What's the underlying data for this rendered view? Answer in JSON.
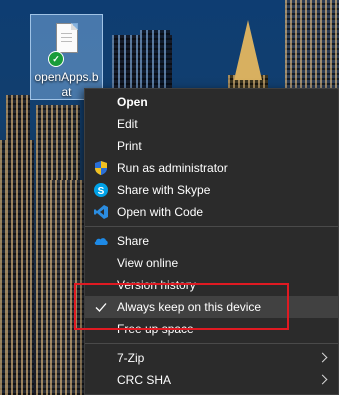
{
  "desktop": {
    "file_icon": {
      "name": "openApps.bat",
      "status_icon": "check-circle-icon"
    }
  },
  "context_menu": {
    "items": [
      {
        "label": "Open",
        "bold": true
      },
      {
        "label": "Edit"
      },
      {
        "label": "Print"
      },
      {
        "label": "Run as administrator",
        "icon": "shield-icon"
      },
      {
        "label": "Share with Skype",
        "icon": "skype-icon"
      },
      {
        "label": "Open with Code",
        "icon": "vscode-icon"
      },
      {
        "label": "Share",
        "icon": "onedrive-cloud-icon"
      },
      {
        "label": "View online"
      },
      {
        "label": "Version history"
      },
      {
        "label": "Always keep on this device",
        "checked": true,
        "highlighted": true
      },
      {
        "label": "Free up space"
      },
      {
        "label": "7-Zip",
        "submenu": true
      },
      {
        "label": "CRC SHA",
        "submenu": true
      }
    ]
  },
  "annotation": {
    "color": "#e01a22"
  },
  "colors": {
    "menu_bg": "#2b2b2b",
    "menu_hover": "#414141",
    "text": "#ffffff"
  }
}
